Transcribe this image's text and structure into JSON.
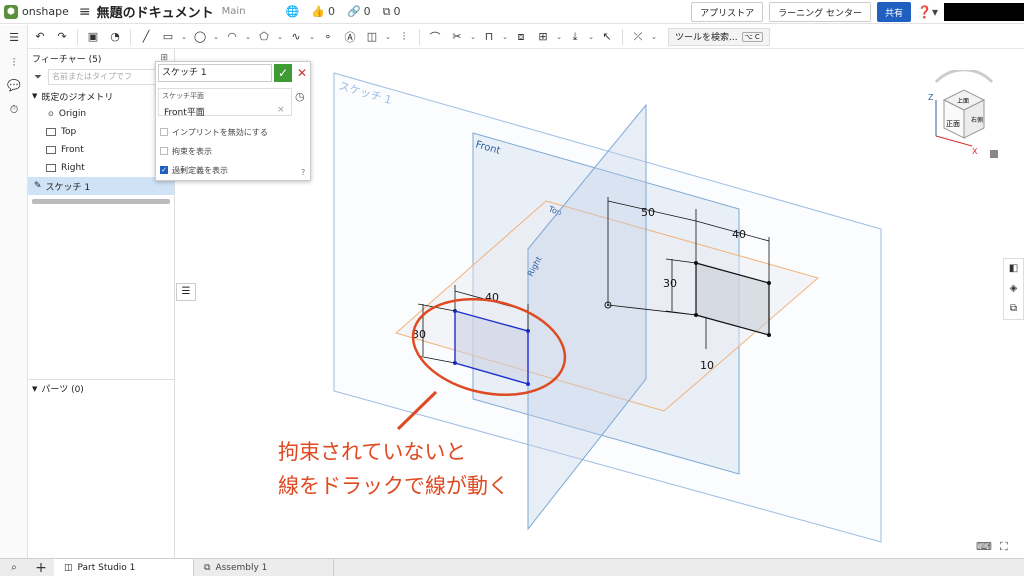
{
  "header": {
    "logo_text": "onshape",
    "doc_title": "無題のドキュメント",
    "branch": "Main",
    "likes": "0",
    "links": "0",
    "copies": "0",
    "app_store_label": "アプリストア",
    "learning_center_label": "ラーニング センター",
    "share_label": "共有"
  },
  "toolbar": {
    "tool_search_label": "ツールを検索...",
    "shortcut": "C"
  },
  "features": {
    "header": "フィーチャー (5)",
    "filter_placeholder": "名前またはタイプでフ",
    "default_geometry": "既定のジオメトリ",
    "origin": "Origin",
    "top": "Top",
    "front": "Front",
    "right": "Right",
    "sketch": "スケッチ 1",
    "parts": "パーツ (0)"
  },
  "sketch_dialog": {
    "name": "スケッチ 1",
    "plane_label": "スケッチ平面",
    "plane_value": "Front平面",
    "opt_imprint": "インプリントを無効にする",
    "opt_constraints": "拘束を表示",
    "opt_overdefined": "過剰定義を表示",
    "opt_imprint_checked": false,
    "opt_constraints_checked": false,
    "opt_overdefined_checked": true
  },
  "viewport": {
    "sketch_plane_label": "スケッチ 1",
    "front_label": "Front",
    "top_label": "Top",
    "right_label": "Right",
    "dim_50": "50",
    "dim_40_right": "40",
    "dim_30_right": "30",
    "dim_10": "10",
    "dim_40_left": "40",
    "dim_30_left": "30",
    "annotation_line1": "拘束されていないと",
    "annotation_line2": "線をドラックで線が動く",
    "viewcube_top": "上面",
    "viewcube_front": "正面",
    "viewcube_right": "右側",
    "axis_z": "Z",
    "axis_x": "X"
  },
  "tabs": [
    {
      "label": "Part Studio 1"
    },
    {
      "label": "Assembly 1"
    }
  ],
  "colors": {
    "accent": "#1f5fbf",
    "annotation": "#e04a22",
    "plane_blue": "#7fa8d6",
    "plane_orange": "#f2b27a",
    "selected_sketch": "#1a2fd0"
  }
}
